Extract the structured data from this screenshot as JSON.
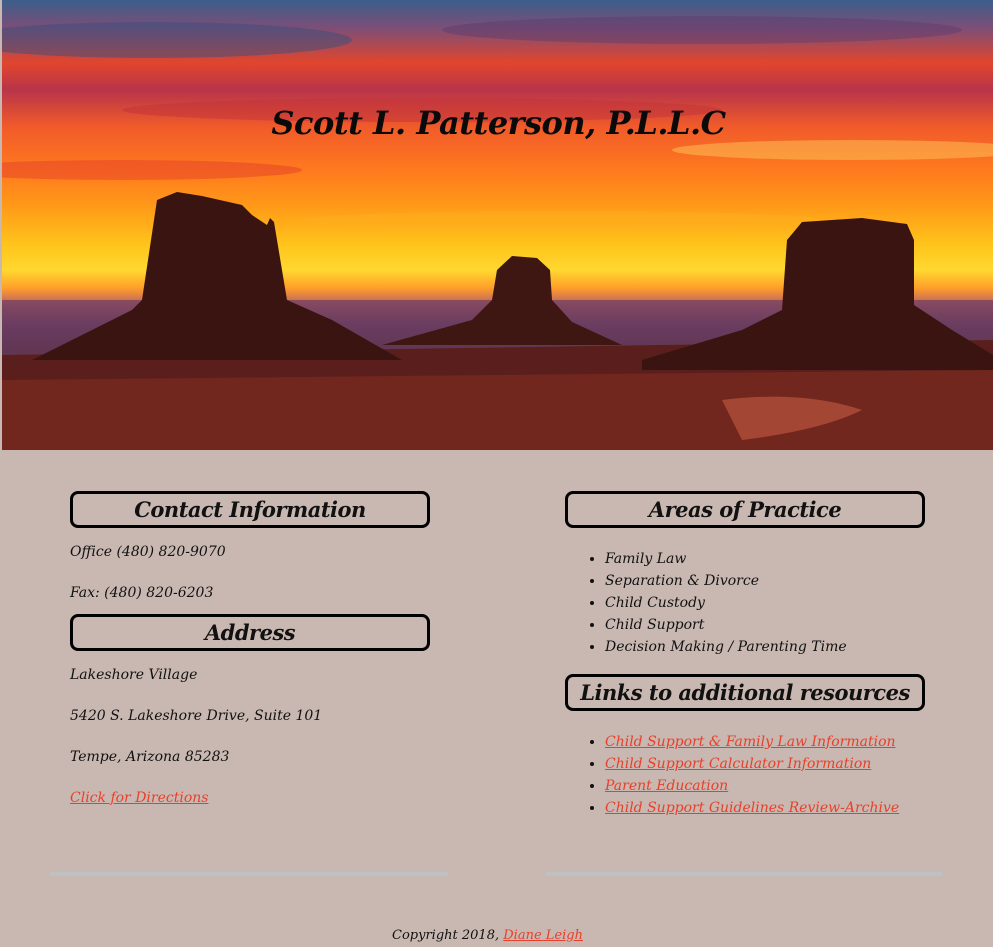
{
  "site": {
    "title": "Scott L. Patterson, P.L.L.C"
  },
  "contact": {
    "heading": "Contact Information",
    "office": "Office (480) 820-9070",
    "fax": "Fax: (480) 820-6203"
  },
  "address": {
    "heading": "Address",
    "line1": "Lakeshore Village",
    "line2": "5420 S. Lakeshore Drive, Suite 101",
    "line3": "Tempe, Arizona 85283",
    "directions_link": "Click for Directions"
  },
  "practice": {
    "heading": "Areas of Practice",
    "items": [
      "Family Law",
      "Separation & Divorce",
      "Child Custody",
      "Child Support",
      "Decision Making / Parenting Time"
    ]
  },
  "resources": {
    "heading": "Links to additional resources",
    "links": [
      "Child Support & Family Law Information",
      "Child Support Calculator Information",
      "Parent Education",
      "Child Support Guidelines Review-Archive"
    ]
  },
  "footer": {
    "copyright": "Copyright 2018, ",
    "author_link": "Diane Leigh"
  },
  "colors": {
    "link": "#e8402a",
    "background": "#c9b8b1"
  }
}
